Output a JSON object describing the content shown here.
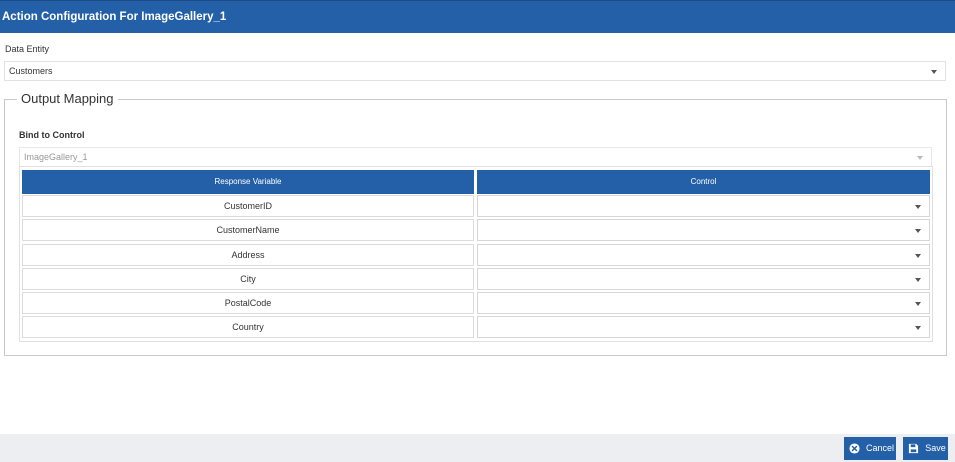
{
  "dialog": {
    "title": "Action Configuration For ImageGallery_1"
  },
  "data_entity": {
    "label": "Data Entity",
    "value": "Customers"
  },
  "output_mapping": {
    "legend": "Output Mapping",
    "bind_label": "Bind to Control",
    "bind_value": "ImageGallery_1",
    "columns": [
      "Response Variable",
      "Control"
    ],
    "rows": [
      {
        "variable": "CustomerID",
        "control": ""
      },
      {
        "variable": "CustomerName",
        "control": ""
      },
      {
        "variable": "Address",
        "control": ""
      },
      {
        "variable": "City",
        "control": ""
      },
      {
        "variable": "PostalCode",
        "control": ""
      },
      {
        "variable": "Country",
        "control": ""
      }
    ]
  },
  "footer": {
    "cancel_label": "Cancel",
    "save_label": "Save"
  },
  "colors": {
    "primary": "#2460a8",
    "footer_bg": "#eceef2",
    "border": "#dcdcdc"
  },
  "icons": {
    "cancel": "times-circle-icon",
    "save": "floppy-disk-icon",
    "dropdown": "chevron-down-icon"
  }
}
